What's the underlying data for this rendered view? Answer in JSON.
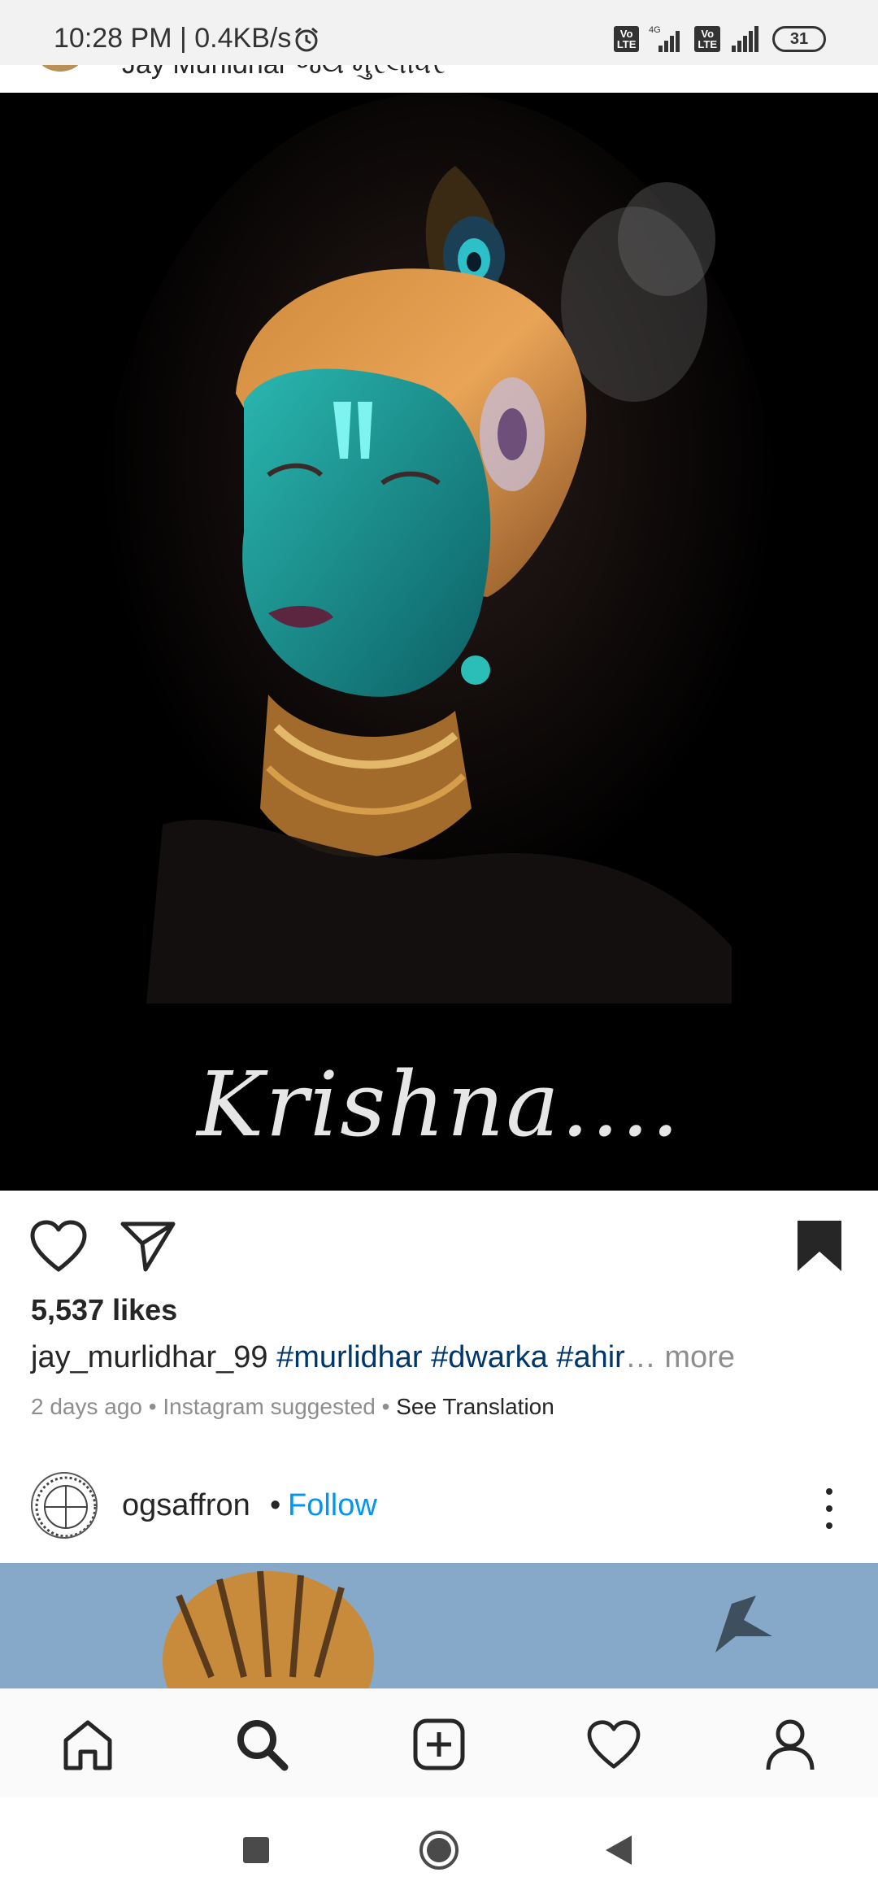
{
  "status_bar": {
    "time": "10:28 PM | 0.4KB/s",
    "network_4g": "4G",
    "volte_1": "Vo LTE",
    "volte_2": "Vo LTE",
    "battery": "31"
  },
  "previous_post": {
    "name": "Jay Murlidhar  જય મુરલીધર"
  },
  "post": {
    "image_text": "Krishna....",
    "likes": "5,537 likes",
    "username": "jay_murlidhar_99",
    "hashtags": "#murlidhar #dwarka #ahir",
    "more": "… more",
    "time_ago": "2 days ago",
    "separator": " • ",
    "suggested": "Instagram suggested",
    "see_translation": "See Translation"
  },
  "next_post": {
    "username": "ogsaffron",
    "dot": "•",
    "follow": "Follow"
  },
  "bottom_nav": {
    "items": [
      "home",
      "search",
      "new-post",
      "activity",
      "profile"
    ]
  },
  "colors": {
    "accent_blue": "#0095f6",
    "hashtag_blue": "#00376b",
    "text_primary": "#262626",
    "text_secondary": "#8e8e8e"
  }
}
